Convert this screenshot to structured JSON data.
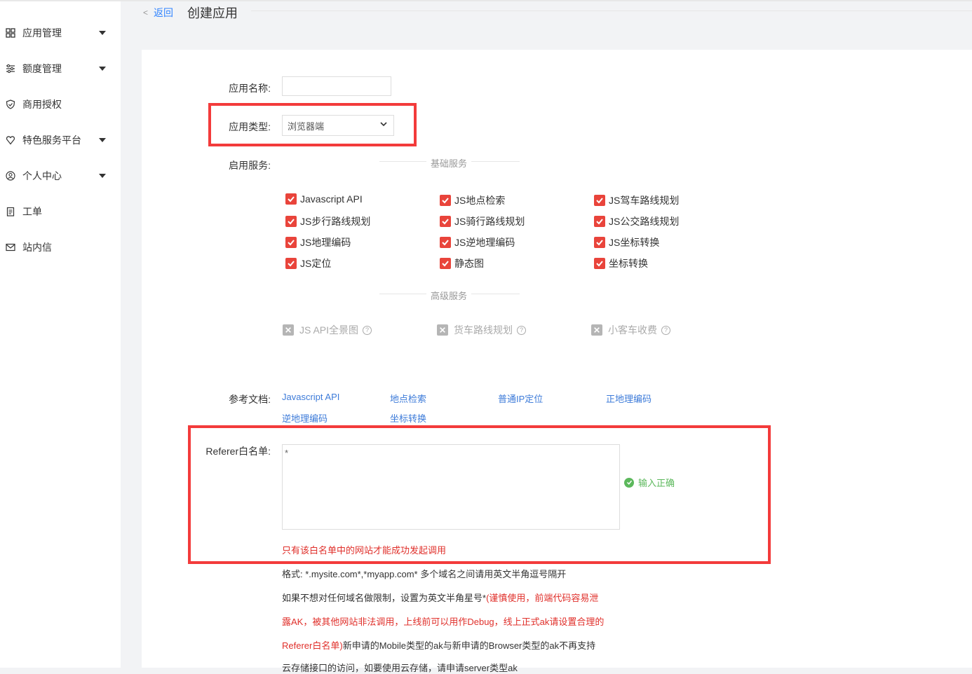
{
  "sidebar": {
    "items": [
      {
        "label": "应用管理",
        "icon": "grid-icon",
        "expandable": true
      },
      {
        "label": "额度管理",
        "icon": "sliders-icon",
        "expandable": true
      },
      {
        "label": "商用授权",
        "icon": "shield-check-icon",
        "expandable": false
      },
      {
        "label": "特色服务平台",
        "icon": "heart-shield-icon",
        "expandable": true
      },
      {
        "label": "个人中心",
        "icon": "user-circle-icon",
        "expandable": true
      },
      {
        "label": "工单",
        "icon": "clipboard-icon",
        "expandable": false
      },
      {
        "label": "站内信",
        "icon": "mail-icon",
        "expandable": false
      }
    ]
  },
  "header": {
    "back": "返回",
    "title": "创建应用"
  },
  "form": {
    "name_label": "应用名称:",
    "name_value": "",
    "type_label": "应用类型:",
    "type_value": "浏览器端",
    "services_label": "启用服务:",
    "basic_title": "基础服务",
    "basic_services": [
      "Javascript API",
      "JS地点检索",
      "JS驾车路线规划",
      "JS步行路线规划",
      "JS骑行路线规划",
      "JS公交路线规划",
      "JS地理编码",
      "JS逆地理编码",
      "JS坐标转换",
      "JS定位",
      "静态图",
      "坐标转换"
    ],
    "advanced_title": "高级服务",
    "advanced_services": [
      "JS API全景图",
      "货车路线规划",
      "小客车收费"
    ],
    "docs_label": "参考文档:",
    "docs": [
      "Javascript API",
      "地点检索",
      "普通IP定位",
      "正地理编码",
      "逆地理编码",
      "坐标转换"
    ],
    "referer_label": "Referer白名单:",
    "referer_value": "*",
    "referer_status": "输入正确",
    "referer_warning": "只有该白名单中的网站才能成功发起调用",
    "note_format": "格式: *.mysite.com*,*myapp.com* 多个域名之间请用英文半角逗号隔开",
    "note2_a": "如果不想对任何域名做限制，设置为英文半角星号*",
    "note2_b": "(谨慎使用，前端代码容易泄",
    "note3": "露AK，被其他网站非法调用，上线前可以用作Debug，线上正式ak请设置合理的",
    "note4_a": "Referer白名单)",
    "note4_b": "新申请的Mobile类型的ak与新申请的Browser类型的ak不再支持",
    "note5": "云存储接口的访问，如要使用云存储，请申请server类型ak"
  },
  "colors": {
    "accent_red": "#e9443b",
    "link": "#3d7bd9",
    "success": "#5cb85c",
    "highlight": "#f33b3b"
  }
}
